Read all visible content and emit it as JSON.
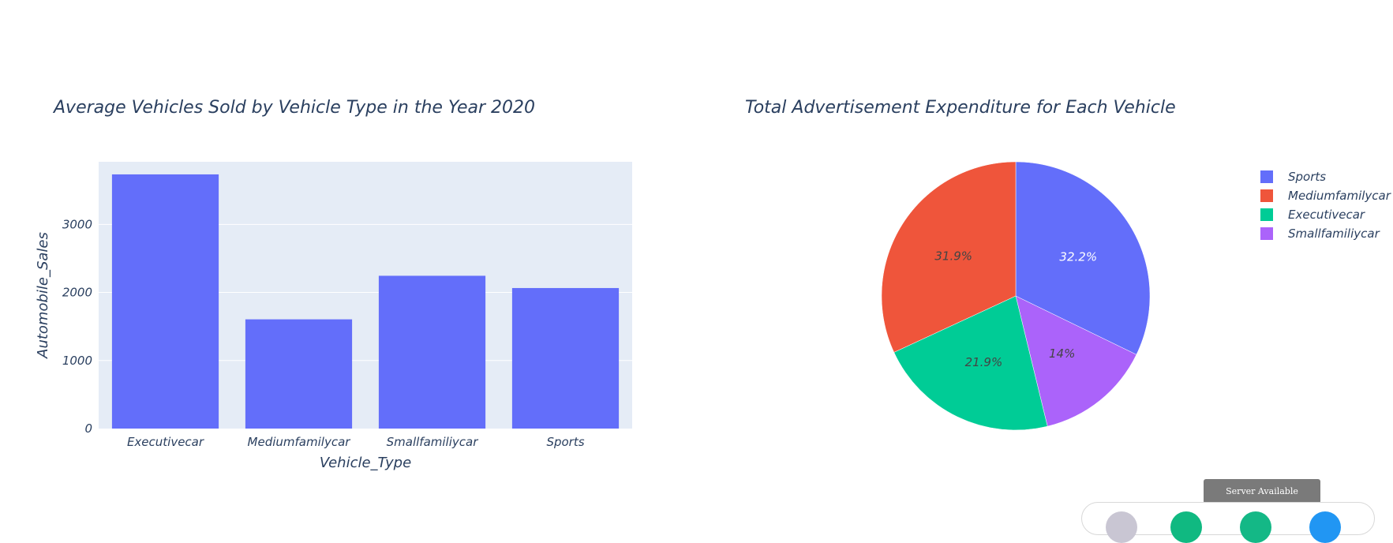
{
  "bar_chart": {
    "title": "Average Vehicles Sold by Vehicle Type in the Year 2020",
    "xlabel": "Vehicle_Type",
    "ylabel": "Automobile_Sales",
    "bar_color": "#636efa",
    "plot_bg": "#e5ecf6"
  },
  "pie_chart": {
    "title": "Total Advertisement Expenditure for Each Vehicle"
  },
  "status": {
    "server_label": "Server Available"
  },
  "chart_data": [
    {
      "type": "bar",
      "title": "Average Vehicles Sold by Vehicle Type in the Year 2020",
      "xlabel": "Vehicle_Type",
      "ylabel": "Automobile_Sales",
      "categories": [
        "Executivecar",
        "Mediumfamilycar",
        "Smallfamiliycar",
        "Sports"
      ],
      "values": [
        3735,
        1605,
        2245,
        2065
      ],
      "ylim": [
        0,
        3920
      ],
      "yticks": [
        0,
        1000,
        2000,
        3000
      ],
      "grid": true
    },
    {
      "type": "pie",
      "title": "Total Advertisement Expenditure for Each Vehicle",
      "labels": [
        "Sports",
        "Mediumfamilycar",
        "Executivecar",
        "Smallfamiliycar"
      ],
      "values": [
        32.2,
        31.9,
        21.9,
        14.0
      ],
      "percent_labels": [
        "32.2%",
        "31.9%",
        "21.9%",
        "14%"
      ],
      "colors": [
        "#636efa",
        "#ef553b",
        "#00cc96",
        "#ab63fa"
      ],
      "slice_order": [
        "Sports",
        "Smallfamiliycar",
        "Executivecar",
        "Mediumfamilycar"
      ],
      "legend_position": "top-right"
    }
  ]
}
